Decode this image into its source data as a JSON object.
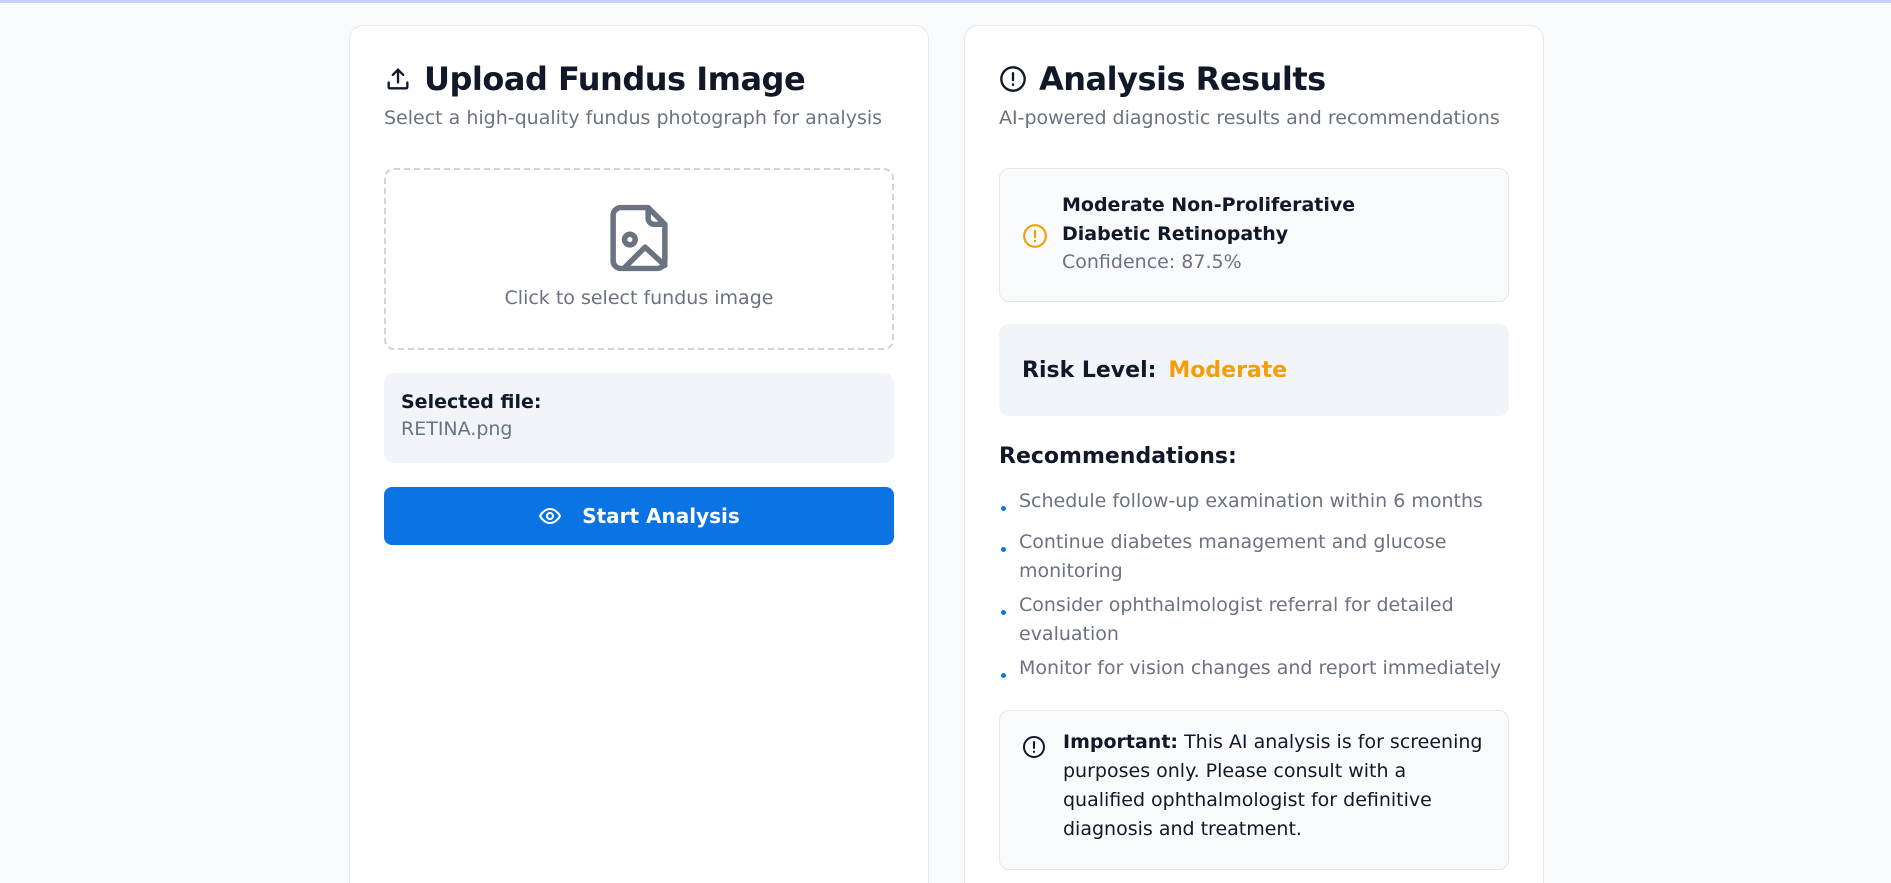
{
  "upload_panel": {
    "title": "Upload Fundus Image",
    "subtitle": "Select a high-quality fundus photograph for analysis",
    "dropzone_text": "Click to select fundus image",
    "selected_file_label": "Selected file:",
    "selected_file_name": "RETINA.png",
    "start_button_label": "Start Analysis",
    "icons": [
      "upload-icon",
      "image-file-icon",
      "eye-icon"
    ]
  },
  "results_panel": {
    "title": "Analysis Results",
    "subtitle": "AI-powered diagnostic results and recommendations",
    "diagnosis": {
      "name": "Moderate Non-Proliferative Diabetic Retinopathy",
      "confidence": "Confidence: 87.5%"
    },
    "risk": {
      "label": "Risk Level:",
      "value": "Moderate",
      "color": "#f59e0b"
    },
    "recommendations_title": "Recommendations:",
    "recommendations": [
      "Schedule follow-up examination within 6 months",
      "Continue diabetes management and glucose monitoring",
      "Consider ophthalmologist referral for detailed evaluation",
      "Monitor for vision changes and report immediately"
    ],
    "disclaimer": {
      "label": "Important:",
      "text": "This AI analysis is for screening purposes only. Please consult with a qualified ophthalmologist for definitive diagnosis and treatment."
    },
    "icons": [
      "alert-circle-icon",
      "warning-circle-icon",
      "info-circle-icon"
    ]
  },
  "colors": {
    "accent": "#0b74e5",
    "warning": "#f59e0b",
    "text_primary": "#111827",
    "text_muted": "#6b7280"
  }
}
